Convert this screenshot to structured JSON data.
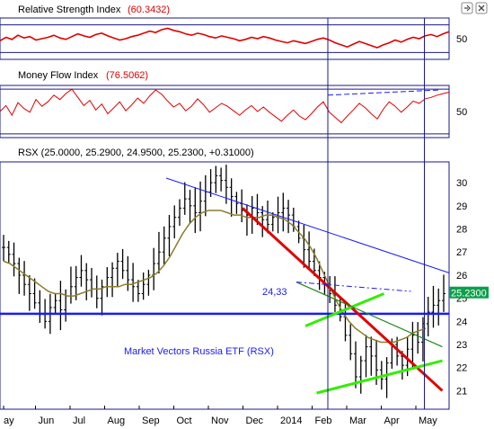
{
  "colors": {
    "price": "#000000",
    "indicator": "#e00000",
    "sma": "#8b7d2a",
    "support": "#1a1aff",
    "trendline": "#1a1aff",
    "downtrend": "#e00000",
    "channel": "#33ee00",
    "channel_mid": "#1a8a1a",
    "frame": "#1a1a8c",
    "last_label_bg": "#0aa04a"
  },
  "icons": [
    "minimize-icon",
    "close-icon"
  ],
  "panels": {
    "rsi": {
      "title": "Relative Strength Index",
      "value": "(60.3432)"
    },
    "mfi": {
      "title": "Money Flow Index",
      "value": "(76.5062)"
    },
    "price": {
      "title": "RSX (25.0000, 25.2900, 24.9500, 25.2300, +0.31000)"
    }
  },
  "chart_data": [
    {
      "type": "line",
      "title": "Relative Strength Index",
      "reading": "60.3432",
      "y_ticks": [
        "50"
      ],
      "ylim": [
        20,
        80
      ],
      "reference_lines": [
        70,
        30
      ],
      "values": [
        47,
        52,
        49,
        55,
        51,
        53,
        48,
        50,
        52,
        55,
        51,
        49,
        53,
        57,
        54,
        52,
        56,
        58,
        54,
        51,
        48,
        50,
        53,
        55,
        58,
        61,
        59,
        63,
        65,
        62,
        60,
        57,
        55,
        58,
        56,
        53,
        51,
        54,
        52,
        50,
        47,
        49,
        52,
        50,
        53,
        51,
        48,
        46,
        44,
        47,
        45,
        43,
        46,
        49,
        51,
        48,
        44,
        41,
        38,
        42,
        46,
        43,
        40,
        37,
        41,
        44,
        48,
        45,
        49,
        52,
        50,
        54,
        56,
        53,
        57,
        60
      ]
    },
    {
      "type": "line",
      "title": "Money Flow Index",
      "reading": "76.5062",
      "y_ticks": [
        "50"
      ],
      "ylim": [
        15,
        85
      ],
      "reference_lines": [
        80,
        20
      ],
      "values": [
        50,
        58,
        45,
        62,
        54,
        49,
        66,
        57,
        63,
        72,
        66,
        74,
        80,
        69,
        58,
        65,
        52,
        60,
        47,
        55,
        63,
        51,
        59,
        68,
        61,
        71,
        79,
        73,
        64,
        56,
        61,
        51,
        57,
        67,
        59,
        49,
        55,
        61,
        57,
        51,
        45,
        52,
        58,
        50,
        56,
        49,
        43,
        37,
        45,
        52,
        44,
        39,
        47,
        56,
        63,
        49,
        42,
        35,
        44,
        52,
        61,
        55,
        47,
        40,
        53,
        63,
        57,
        49,
        56,
        64,
        61,
        67,
        69,
        72,
        74,
        76
      ]
    },
    {
      "type": "candlestick",
      "title": "RSX (25.0000, 25.2900, 24.9500, 25.2300, +0.31000)",
      "instrument": "Market Vectors Russia ETF (RSX)",
      "last_value": "25.2300",
      "support_label": "24,33",
      "x_tick_labels": [
        "ay",
        "Jun",
        "Jul",
        "Aug",
        "Sep",
        "Oct",
        "Nov",
        "Dec",
        "2014",
        "Feb",
        "Mar",
        "Apr",
        "May"
      ],
      "y_ticks": [
        21,
        22,
        23,
        24,
        25,
        26,
        27,
        28,
        29,
        30
      ],
      "ylim": [
        20.2,
        30.9
      ],
      "close": [
        27.2,
        26.9,
        26.5,
        26.0,
        25.6,
        25.2,
        24.8,
        24.3,
        24.0,
        24.6,
        24.9,
        24.5,
        25.1,
        25.5,
        25.9,
        26.2,
        25.8,
        25.4,
        25.0,
        25.5,
        25.9,
        26.3,
        26.6,
        26.2,
        25.8,
        25.5,
        25.2,
        25.6,
        26.0,
        26.5,
        27.0,
        27.6,
        28.1,
        28.5,
        28.9,
        29.3,
        29.0,
        28.7,
        29.2,
        29.6,
        30.0,
        30.3,
        30.1,
        29.8,
        29.4,
        29.1,
        28.8,
        28.6,
        28.9,
        28.7,
        28.4,
        28.2,
        28.5,
        28.7,
        28.9,
        28.6,
        28.1,
        27.6,
        27.1,
        26.6,
        26.2,
        25.9,
        25.6,
        25.2,
        24.7,
        24.2,
        23.4,
        22.6,
        21.6,
        22.3,
        22.9,
        22.5,
        21.9,
        21.5,
        22.2,
        23.0,
        22.5,
        22.1,
        22.8,
        23.4,
        23.1,
        23.9,
        24.4,
        24.7,
        24.9,
        25.2
      ],
      "sma": [
        26.6,
        26.5,
        26.3,
        26.1,
        25.9,
        25.7,
        25.5,
        25.3,
        25.2,
        25.2,
        25.1,
        25.1,
        25.2,
        25.3,
        25.4,
        25.4,
        25.5,
        25.5,
        25.5,
        25.6,
        25.6,
        25.7,
        25.8,
        25.9,
        26.1,
        26.4,
        26.8,
        27.3,
        27.8,
        28.2,
        28.5,
        28.7,
        28.8,
        28.8,
        28.8,
        28.7,
        28.6,
        28.6,
        28.5,
        28.5,
        28.5,
        28.6,
        28.6,
        28.5,
        28.4,
        28.2,
        27.9,
        27.6,
        27.2,
        26.7,
        26.1,
        25.5,
        24.9,
        24.4,
        24.0,
        23.7,
        23.5,
        23.3,
        23.2,
        23.1,
        23.1,
        23.1,
        23.2,
        23.3,
        23.5,
        23.6,
        23.7
      ],
      "annotations": [
        {
          "kind": "horizontal",
          "name": "support",
          "value": 24.33
        },
        {
          "kind": "trendline",
          "name": "upper trendline",
          "from": [
            0.37,
            30.2
          ],
          "to": [
            1.0,
            26.1
          ]
        },
        {
          "kind": "trendline",
          "name": "downtrend",
          "from": [
            0.54,
            28.9
          ],
          "to": [
            0.985,
            21.0
          ]
        },
        {
          "kind": "channel",
          "name": "rising channel",
          "upper": [
            [
              0.68,
              23.8
            ],
            [
              0.855,
              25.2
            ]
          ],
          "lower": [
            [
              0.705,
              20.9
            ],
            [
              0.985,
              22.3
            ]
          ],
          "middle": [
            [
              0.66,
              25.7
            ],
            [
              0.985,
              22.9
            ]
          ]
        },
        {
          "kind": "dashed",
          "name": "dash-dot resistance",
          "from": [
            0.66,
            25.7
          ],
          "to": [
            0.915,
            25.3
          ]
        }
      ]
    }
  ],
  "price_panel": {
    "support_label": "24,33",
    "caption": "Market Vectors Russia ETF (RSX)",
    "last_value": "25.2300"
  }
}
